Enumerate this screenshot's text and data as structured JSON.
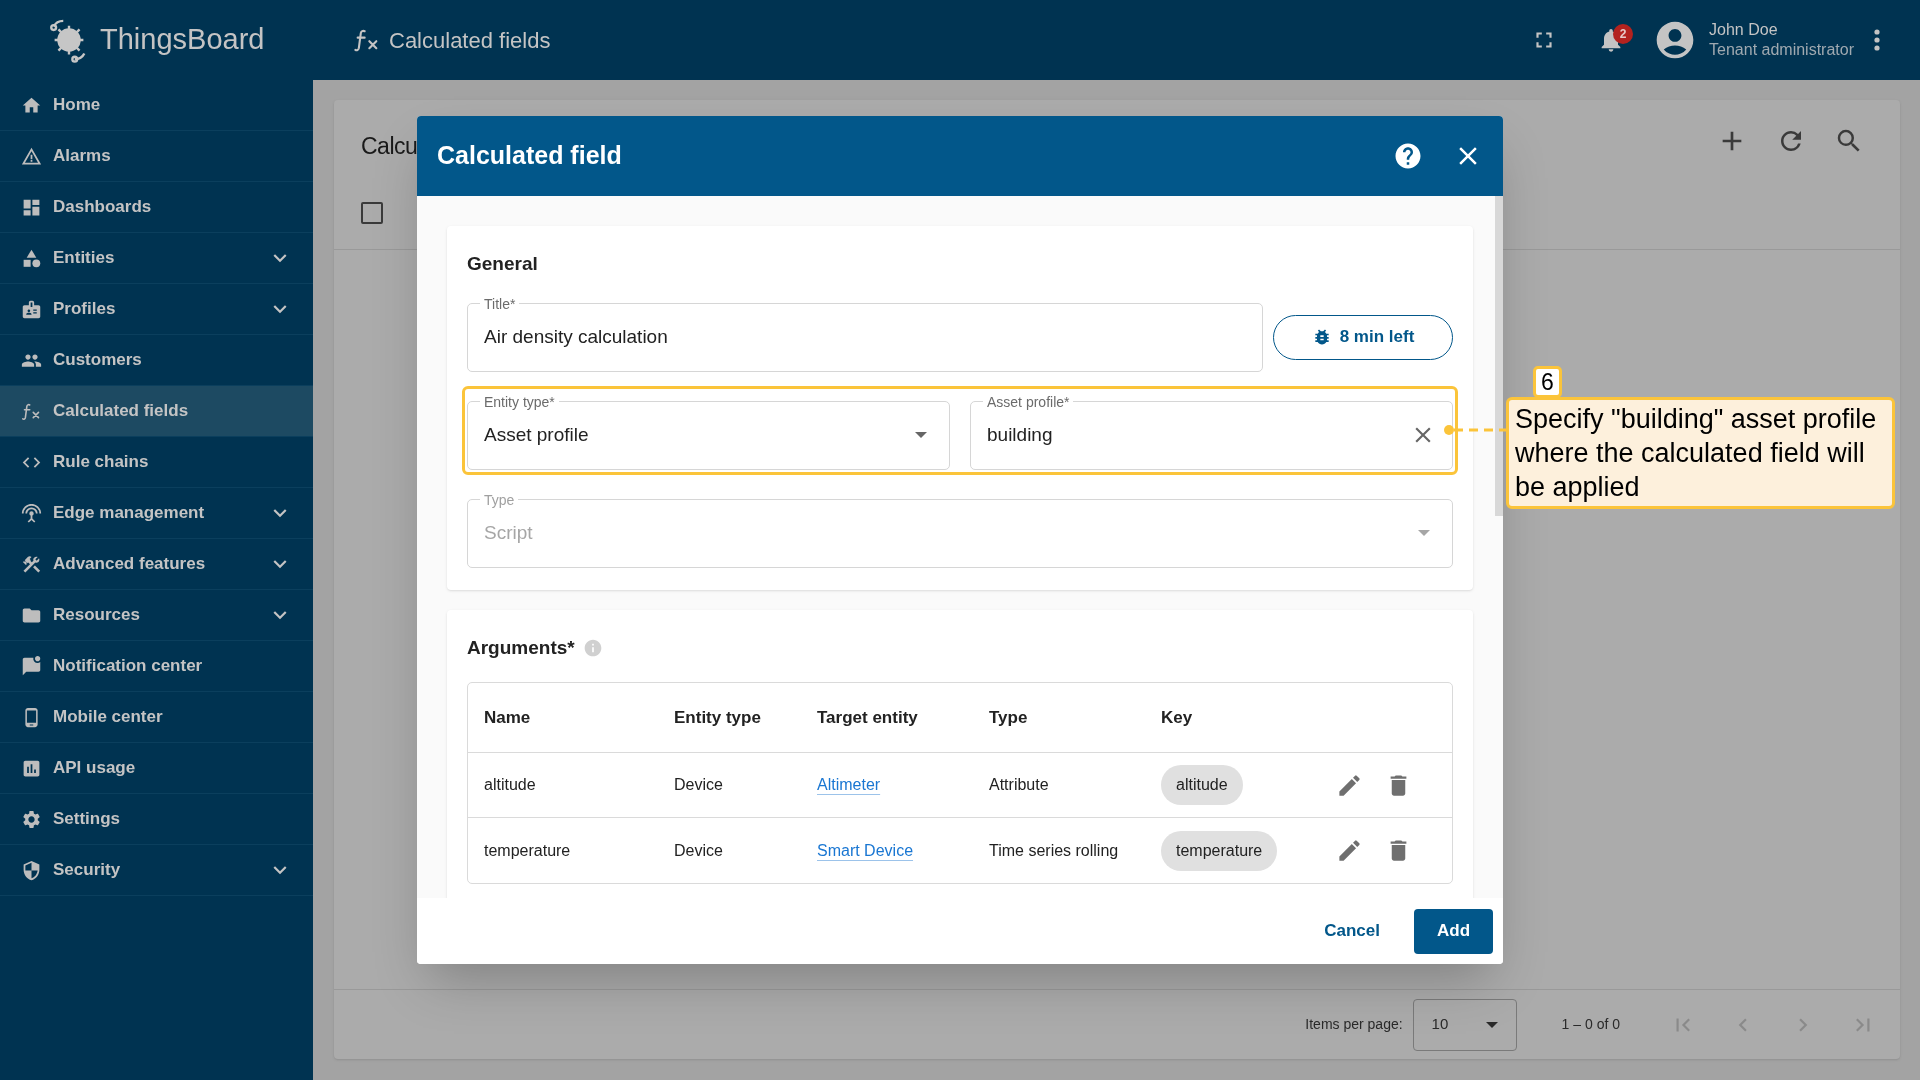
{
  "header": {
    "logo_text": "ThingsBoard",
    "page_title": "Calculated fields",
    "notification_count": "2",
    "user_name": "John Doe",
    "user_role": "Tenant administrator"
  },
  "sidebar": {
    "items": [
      {
        "label": "Home",
        "selected": false,
        "expandable": false
      },
      {
        "label": "Alarms",
        "selected": false,
        "expandable": false
      },
      {
        "label": "Dashboards",
        "selected": false,
        "expandable": false
      },
      {
        "label": "Entities",
        "selected": false,
        "expandable": true
      },
      {
        "label": "Profiles",
        "selected": false,
        "expandable": true
      },
      {
        "label": "Customers",
        "selected": false,
        "expandable": false
      },
      {
        "label": "Calculated fields",
        "selected": true,
        "expandable": false
      },
      {
        "label": "Rule chains",
        "selected": false,
        "expandable": false
      },
      {
        "label": "Edge management",
        "selected": false,
        "expandable": true
      },
      {
        "label": "Advanced features",
        "selected": false,
        "expandable": true
      },
      {
        "label": "Resources",
        "selected": false,
        "expandable": true
      },
      {
        "label": "Notification center",
        "selected": false,
        "expandable": false
      },
      {
        "label": "Mobile center",
        "selected": false,
        "expandable": false
      },
      {
        "label": "API usage",
        "selected": false,
        "expandable": false
      },
      {
        "label": "Settings",
        "selected": false,
        "expandable": false
      },
      {
        "label": "Security",
        "selected": false,
        "expandable": true
      }
    ]
  },
  "page": {
    "title": "Calcu",
    "select_all_checked": false
  },
  "pagination": {
    "items_per_page_label": "Items per page:",
    "page_size": "10",
    "range": "1 – 0 of 0"
  },
  "dialog": {
    "title": "Calculated field",
    "general": {
      "heading": "General",
      "title_field": {
        "label": "Title*",
        "value": "Air density calculation"
      },
      "timer_button": "8 min left",
      "entity_type": {
        "label": "Entity type*",
        "value": "Asset profile"
      },
      "asset_profile": {
        "label": "Asset profile*",
        "value": "building"
      },
      "type": {
        "label": "Type",
        "value": "Script",
        "disabled": true
      }
    },
    "arguments": {
      "heading": "Arguments*",
      "columns": [
        "Name",
        "Entity type",
        "Target entity",
        "Type",
        "Key"
      ],
      "rows": [
        {
          "name": "altitude",
          "entity_type": "Device",
          "target_entity": "Altimeter",
          "type": "Attribute",
          "key": "altitude"
        },
        {
          "name": "temperature",
          "entity_type": "Device",
          "target_entity": "Smart Device",
          "type": "Time series rolling",
          "key": "temperature"
        }
      ]
    },
    "buttons": {
      "cancel": "Cancel",
      "add": "Add"
    }
  },
  "callout": {
    "number": "6",
    "text": "Specify \"building\" asset profile where the calculated field will be applied"
  }
}
